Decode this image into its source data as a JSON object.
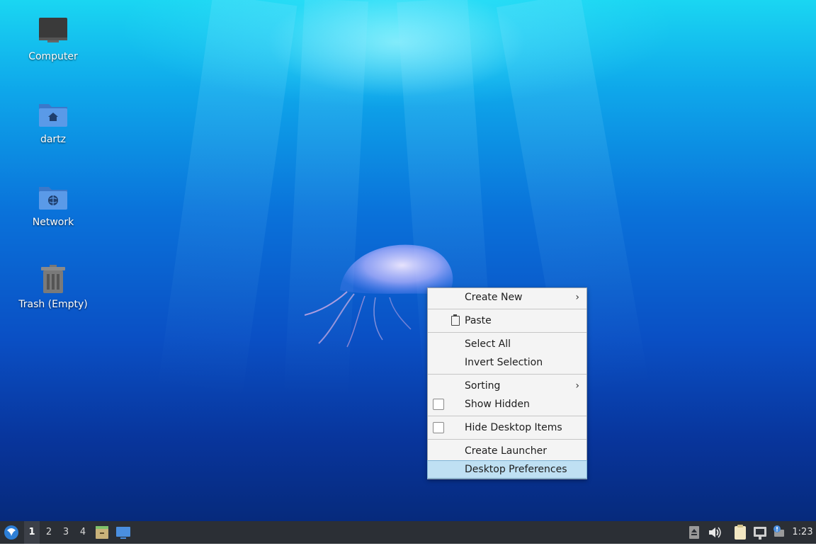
{
  "desktop": {
    "icons": [
      {
        "label": "Computer",
        "icon": "computer-icon"
      },
      {
        "label": "dartz",
        "icon": "home-folder-icon"
      },
      {
        "label": "Network",
        "icon": "network-folder-icon"
      },
      {
        "label": "Trash (Empty)",
        "icon": "trash-icon"
      }
    ]
  },
  "context_menu": {
    "items": {
      "create_new": "Create New",
      "paste": "Paste",
      "select_all": "Select All",
      "invert_selection": "Invert Selection",
      "sorting": "Sorting",
      "show_hidden": "Show Hidden",
      "hide_desktop_items": "Hide Desktop Items",
      "create_launcher": "Create Launcher",
      "desktop_preferences": "Desktop Preferences"
    },
    "highlighted": "Desktop Preferences"
  },
  "taskbar": {
    "workspaces": [
      "1",
      "2",
      "3",
      "4"
    ],
    "active_workspace": "1",
    "clock": "1:23"
  },
  "colors": {
    "menu_highlight": "#bfe0f3",
    "taskbar_bg": "#2b2f35",
    "folder_blue": "#4a8fe0"
  }
}
